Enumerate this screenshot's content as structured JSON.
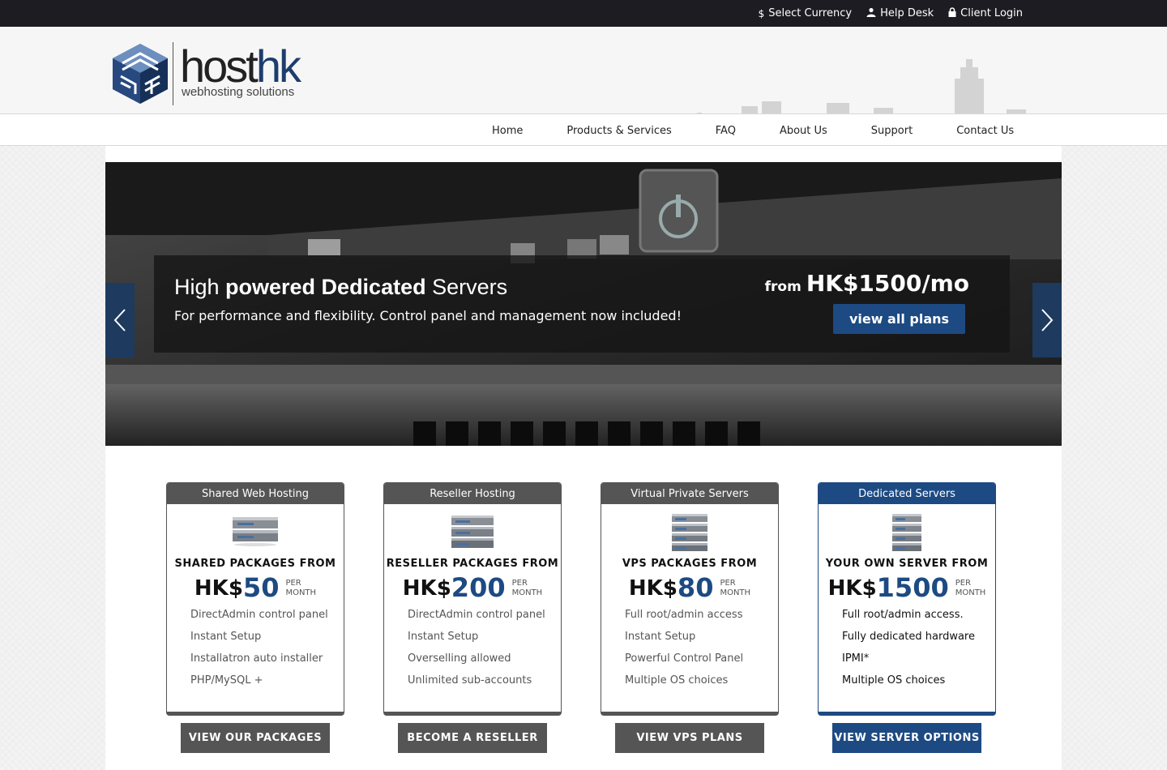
{
  "topbar": {
    "links": [
      {
        "icon": "dollar-icon",
        "label": "Select Currency"
      },
      {
        "icon": "user-icon",
        "label": "Help Desk"
      },
      {
        "icon": "lock-icon",
        "label": "Client Login"
      }
    ]
  },
  "header": {
    "brand_host": "host",
    "brand_hk": "hk",
    "tagline": "webhosting solutions"
  },
  "nav": {
    "items": [
      "Home",
      "Products & Services",
      "FAQ",
      "About Us",
      "Support",
      "Contact Us"
    ]
  },
  "slider": {
    "title_pre": "High ",
    "title_bold": "powered Dedicated",
    "title_post": " Servers",
    "subtitle": "For performance and flexibility. Control panel and management now included!",
    "price_from": "from",
    "price_amount": "HK$1500/mo",
    "button": "view all plans"
  },
  "cards": [
    {
      "header": "Shared Web Hosting",
      "from_label": "SHARED PACKAGES FROM",
      "currency": "HK$",
      "price": "50",
      "per": "PER",
      "period": "MONTH",
      "features": [
        "DirectAdmin control panel",
        "Instant Setup",
        "Installatron auto installer",
        "PHP/MySQL +"
      ],
      "button": "VIEW OUR PACKAGES"
    },
    {
      "header": "Reseller Hosting",
      "from_label": "RESELLER PACKAGES FROM",
      "currency": "HK$",
      "price": "200",
      "per": "PER",
      "period": "MONTH",
      "features": [
        "DirectAdmin control panel",
        "Instant Setup",
        "Overselling allowed",
        "Unlimited sub-accounts"
      ],
      "button": "BECOME A RESELLER"
    },
    {
      "header": "Virtual Private Servers",
      "from_label": "VPS PACKAGES FROM",
      "currency": "HK$",
      "price": "80",
      "per": "PER",
      "period": "MONTH",
      "features": [
        "Full root/admin access",
        "Instant Setup",
        "Powerful Control Panel",
        "Multiple OS choices"
      ],
      "button": "VIEW VPS PLANS"
    },
    {
      "header": "Dedicated Servers",
      "from_label": "YOUR OWN SERVER FROM",
      "currency": "HK$",
      "price": "1500",
      "per": "PER",
      "period": "MONTH",
      "features": [
        "Full root/admin access.",
        "Fully dedicated hardware",
        "IPMI*",
        "Multiple OS choices"
      ],
      "button": "VIEW SERVER OPTIONS"
    }
  ],
  "colors": {
    "brand_blue": "#1d4a82",
    "topbar": "#1c1c22",
    "card_gray": "#555555"
  }
}
